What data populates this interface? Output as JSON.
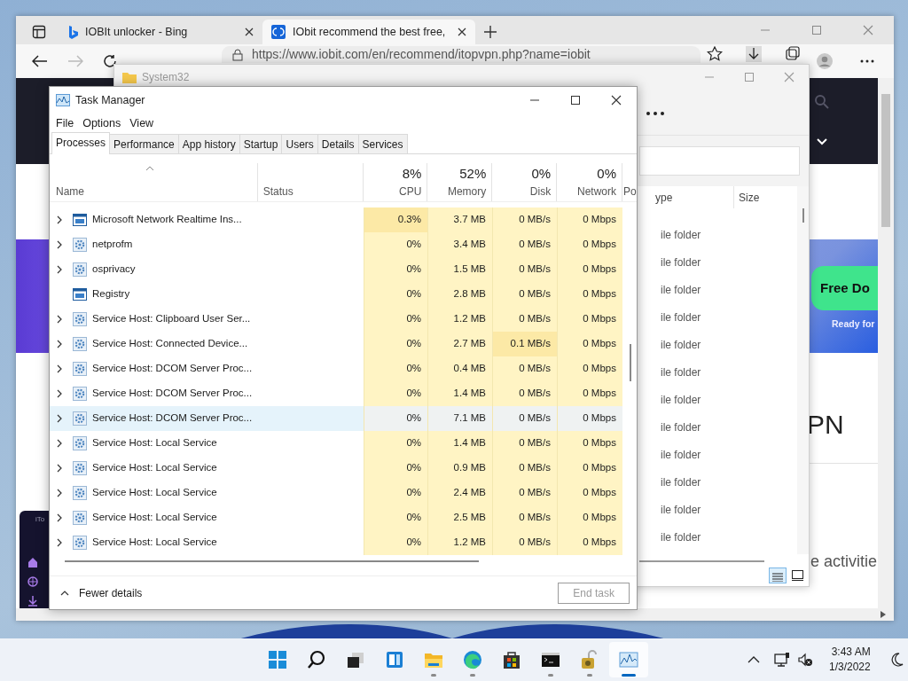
{
  "browser": {
    "tabs": [
      {
        "title": "IOBIt unlocker - Bing",
        "selected": false
      },
      {
        "title": "IObit recommend the best free,",
        "selected": true
      }
    ],
    "address": "https://www.iobit.com/en/recommend/itopvpn.php?name=iobit",
    "page": {
      "banner_button": "Free Do",
      "banner_caption": "Ready for",
      "heading_fragment": "PN",
      "text_fragment": "e activitie",
      "panel_label": "iTo"
    }
  },
  "explorer": {
    "title": "System32",
    "columns": [
      "ype",
      "Size"
    ],
    "rows": [
      "ile folder",
      "ile folder",
      "ile folder",
      "ile folder",
      "ile folder",
      "ile folder",
      "ile folder",
      "ile folder",
      "ile folder",
      "ile folder",
      "ile folder",
      "ile folder"
    ]
  },
  "task_manager": {
    "title": "Task Manager",
    "menu": [
      "File",
      "Options",
      "View"
    ],
    "tabs": [
      {
        "label": "Processes",
        "selected": true
      },
      {
        "label": "Performance",
        "selected": false
      },
      {
        "label": "App history",
        "selected": false
      },
      {
        "label": "Startup",
        "selected": false
      },
      {
        "label": "Users",
        "selected": false
      },
      {
        "label": "Details",
        "selected": false
      },
      {
        "label": "Services",
        "selected": false
      }
    ],
    "name_header": "Name",
    "status_header": "Status",
    "metrics": [
      {
        "label": "CPU",
        "total": "8%"
      },
      {
        "label": "Memory",
        "total": "52%"
      },
      {
        "label": "Disk",
        "total": "0%"
      },
      {
        "label": "Network",
        "total": "0%"
      }
    ],
    "cut_header": "Po",
    "rows": [
      {
        "name": "Microsoft Network Realtime Ins...",
        "kind": "app",
        "expandable": true,
        "hovered": false,
        "cells": [
          {
            "text": "0.3%",
            "color": "#fce9a6"
          },
          {
            "text": "3.7 MB",
            "color": "#fff4c4"
          },
          {
            "text": "0 MB/s",
            "color": "#fff4c4"
          },
          {
            "text": "0 Mbps",
            "color": "#fff4c4"
          }
        ]
      },
      {
        "name": "netprofm",
        "kind": "service",
        "expandable": true,
        "hovered": false,
        "cells": [
          {
            "text": "0%",
            "color": "#fff4c4"
          },
          {
            "text": "3.4 MB",
            "color": "#fff4c4"
          },
          {
            "text": "0 MB/s",
            "color": "#fff4c4"
          },
          {
            "text": "0 Mbps",
            "color": "#fff4c4"
          }
        ]
      },
      {
        "name": "osprivacy",
        "kind": "service",
        "expandable": true,
        "hovered": false,
        "cells": [
          {
            "text": "0%",
            "color": "#fff4c4"
          },
          {
            "text": "1.5 MB",
            "color": "#fff4c4"
          },
          {
            "text": "0 MB/s",
            "color": "#fff4c4"
          },
          {
            "text": "0 Mbps",
            "color": "#fff4c4"
          }
        ]
      },
      {
        "name": "Registry",
        "kind": "app",
        "expandable": false,
        "hovered": false,
        "cells": [
          {
            "text": "0%",
            "color": "#fff4c4"
          },
          {
            "text": "2.8 MB",
            "color": "#fff4c4"
          },
          {
            "text": "0 MB/s",
            "color": "#fff4c4"
          },
          {
            "text": "0 Mbps",
            "color": "#fff4c4"
          }
        ]
      },
      {
        "name": "Service Host: Clipboard User Ser...",
        "kind": "service",
        "expandable": true,
        "hovered": false,
        "cells": [
          {
            "text": "0%",
            "color": "#fff4c4"
          },
          {
            "text": "1.2 MB",
            "color": "#fff4c4"
          },
          {
            "text": "0 MB/s",
            "color": "#fff4c4"
          },
          {
            "text": "0 Mbps",
            "color": "#fff4c4"
          }
        ]
      },
      {
        "name": "Service Host: Connected Device...",
        "kind": "service",
        "expandable": true,
        "hovered": false,
        "cells": [
          {
            "text": "0%",
            "color": "#fff4c4"
          },
          {
            "text": "2.7 MB",
            "color": "#fff4c4"
          },
          {
            "text": "0.1 MB/s",
            "color": "#fce9a6"
          },
          {
            "text": "0 Mbps",
            "color": "#fff4c4"
          }
        ]
      },
      {
        "name": "Service Host: DCOM Server Proc...",
        "kind": "service",
        "expandable": true,
        "hovered": false,
        "cells": [
          {
            "text": "0%",
            "color": "#fff4c4"
          },
          {
            "text": "0.4 MB",
            "color": "#fff4c4"
          },
          {
            "text": "0 MB/s",
            "color": "#fff4c4"
          },
          {
            "text": "0 Mbps",
            "color": "#fff4c4"
          }
        ]
      },
      {
        "name": "Service Host: DCOM Server Proc...",
        "kind": "service",
        "expandable": true,
        "hovered": false,
        "cells": [
          {
            "text": "0%",
            "color": "#fff4c4"
          },
          {
            "text": "1.4 MB",
            "color": "#fff4c4"
          },
          {
            "text": "0 MB/s",
            "color": "#fff4c4"
          },
          {
            "text": "0 Mbps",
            "color": "#fff4c4"
          }
        ]
      },
      {
        "name": "Service Host: DCOM Server Proc...",
        "kind": "service",
        "expandable": true,
        "hovered": true,
        "cells": [
          {
            "text": "0%",
            "color": "#eff2f2"
          },
          {
            "text": "7.1 MB",
            "color": "#eff2f2"
          },
          {
            "text": "0 MB/s",
            "color": "#eff2f2"
          },
          {
            "text": "0 Mbps",
            "color": "#eff2f2"
          }
        ]
      },
      {
        "name": "Service Host: Local Service",
        "kind": "service",
        "expandable": true,
        "hovered": false,
        "cells": [
          {
            "text": "0%",
            "color": "#fff4c4"
          },
          {
            "text": "1.4 MB",
            "color": "#fff4c4"
          },
          {
            "text": "0 MB/s",
            "color": "#fff4c4"
          },
          {
            "text": "0 Mbps",
            "color": "#fff4c4"
          }
        ]
      },
      {
        "name": "Service Host: Local Service",
        "kind": "service",
        "expandable": true,
        "hovered": false,
        "cells": [
          {
            "text": "0%",
            "color": "#fff4c4"
          },
          {
            "text": "0.9 MB",
            "color": "#fff4c4"
          },
          {
            "text": "0 MB/s",
            "color": "#fff4c4"
          },
          {
            "text": "0 Mbps",
            "color": "#fff4c4"
          }
        ]
      },
      {
        "name": "Service Host: Local Service",
        "kind": "service",
        "expandable": true,
        "hovered": false,
        "cells": [
          {
            "text": "0%",
            "color": "#fff4c4"
          },
          {
            "text": "2.4 MB",
            "color": "#fff4c4"
          },
          {
            "text": "0 MB/s",
            "color": "#fff4c4"
          },
          {
            "text": "0 Mbps",
            "color": "#fff4c4"
          }
        ]
      },
      {
        "name": "Service Host: Local Service",
        "kind": "service",
        "expandable": true,
        "hovered": false,
        "cells": [
          {
            "text": "0%",
            "color": "#fff4c4"
          },
          {
            "text": "2.5 MB",
            "color": "#fff4c4"
          },
          {
            "text": "0 MB/s",
            "color": "#fff4c4"
          },
          {
            "text": "0 Mbps",
            "color": "#fff4c4"
          }
        ]
      },
      {
        "name": "Service Host: Local Service",
        "kind": "service",
        "expandable": true,
        "hovered": false,
        "cells": [
          {
            "text": "0%",
            "color": "#fff4c4"
          },
          {
            "text": "1.2 MB",
            "color": "#fff4c4"
          },
          {
            "text": "0 MB/s",
            "color": "#fff4c4"
          },
          {
            "text": "0 Mbps",
            "color": "#fff4c4"
          }
        ]
      }
    ],
    "fewer_details": "Fewer details",
    "end_task": {
      "label": "End task",
      "disabled": true
    }
  },
  "taskbar": {
    "apps": [
      {
        "kind": "start",
        "running": false,
        "selected": false
      },
      {
        "kind": "search",
        "running": false,
        "selected": false
      },
      {
        "kind": "taskview",
        "running": false,
        "selected": false
      },
      {
        "kind": "widgets",
        "running": false,
        "selected": false
      },
      {
        "kind": "explorer",
        "running": true,
        "selected": false
      },
      {
        "kind": "edge",
        "running": true,
        "selected": false
      },
      {
        "kind": "store",
        "running": false,
        "selected": false
      },
      {
        "kind": "terminal",
        "running": true,
        "selected": false
      },
      {
        "kind": "locktool",
        "running": true,
        "selected": false
      },
      {
        "kind": "taskmgr",
        "running": true,
        "selected": true
      }
    ],
    "time": "3:43 AM",
    "date": "1/3/2022"
  }
}
